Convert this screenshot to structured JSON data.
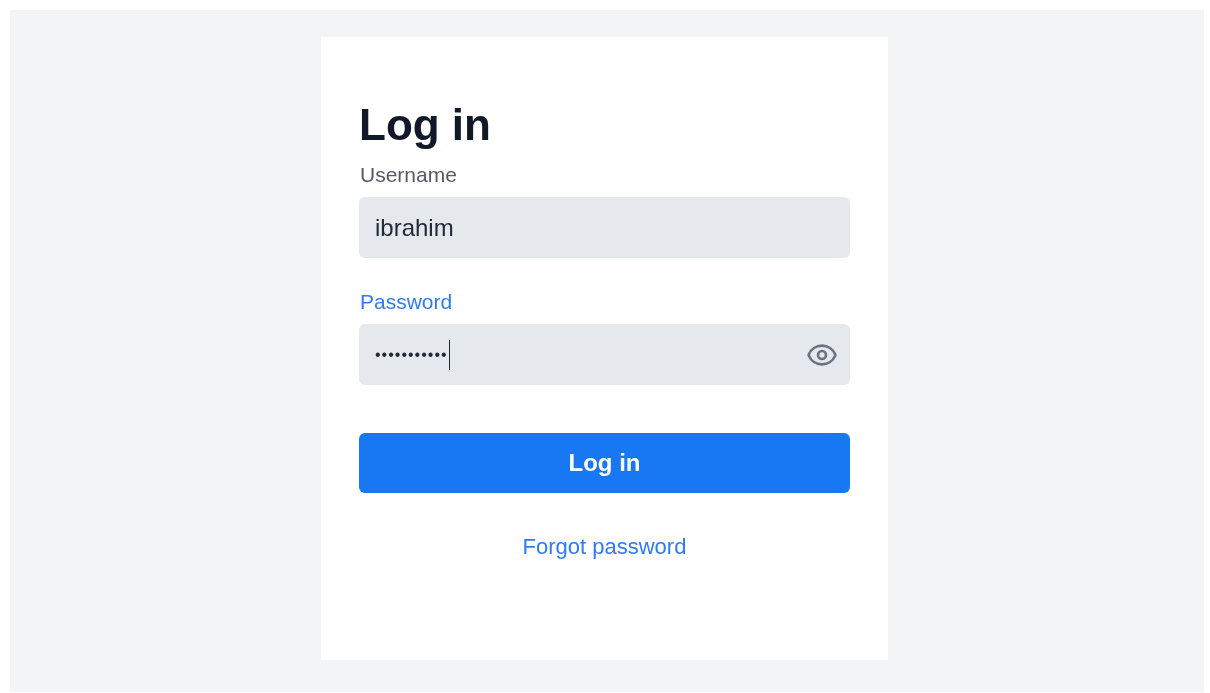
{
  "title": "Log in",
  "fields": [
    {
      "label": "Username",
      "value": "ibrahim",
      "focused": false,
      "kind": "text"
    },
    {
      "label": "Password",
      "value": "•••••••••••",
      "focused": true,
      "kind": "password"
    }
  ],
  "submit_button": "Log in",
  "forgot_link": "Forgot password"
}
